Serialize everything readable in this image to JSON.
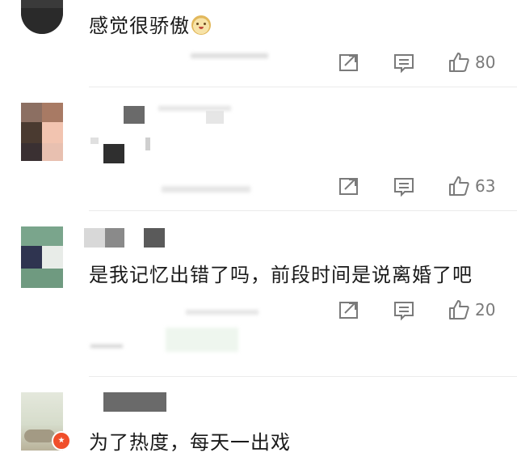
{
  "comments": [
    {
      "text": "感觉很骄傲",
      "emoji": "doge-emoji",
      "likes": "80"
    },
    {
      "text": "",
      "likes": "63"
    },
    {
      "text": "是我记忆出错了吗，前段时间是说离婚了吧",
      "likes": "20"
    },
    {
      "text": "为了热度，每天一出戏"
    }
  ],
  "icons": {
    "share": "share-icon",
    "reply": "comment-icon",
    "like": "thumbs-up-icon"
  },
  "colors": {
    "icon": "#7a7a7a",
    "divider": "#ebebeb",
    "badge": "#f04e2a"
  }
}
